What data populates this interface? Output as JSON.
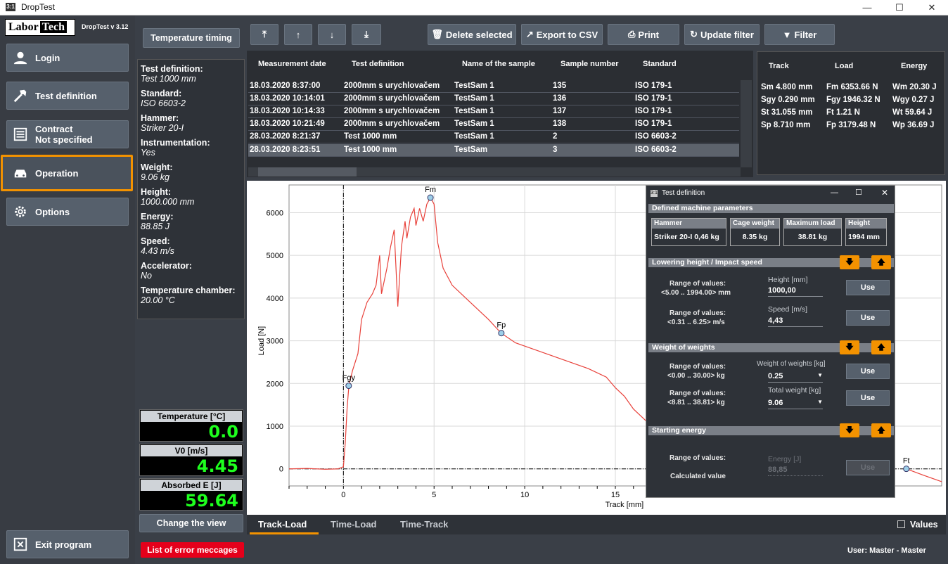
{
  "window": {
    "title": "DropTest",
    "app_icon": "3:1"
  },
  "sidebar": {
    "logo_left": "Labor",
    "logo_right": "Tech",
    "version": "DropTest v 3.12",
    "items": [
      {
        "label": "Login",
        "icon": "user-icon"
      },
      {
        "label": "Test definition",
        "icon": "hammer-icon"
      },
      {
        "label": "Contract",
        "label2": "Not specified",
        "icon": "document-icon"
      },
      {
        "label": "Operation",
        "icon": "car-icon",
        "active": true
      },
      {
        "label": "Options",
        "icon": "gear-icon"
      }
    ],
    "exit": "Exit program"
  },
  "temperature_timing": "Temperature timing",
  "info": {
    "test_definition_label": "Test definition:",
    "test_definition": "Test 1000 mm",
    "standard_label": "Standard:",
    "standard": "ISO 6603-2",
    "hammer_label": "Hammer:",
    "hammer": "Striker 20-I",
    "instrumentation_label": "Instrumentation:",
    "instrumentation": "Yes",
    "weight_label": "Weight:",
    "weight": "9.06   kg",
    "height_label": "Height:",
    "height": "1000.000   mm",
    "energy_label": "Energy:",
    "energy": "88.85   J",
    "speed_label": "Speed:",
    "speed": "4.43   m/s",
    "accelerator_label": "Accelerator:",
    "accelerator": "No",
    "chamber_label": "Temperature chamber:",
    "chamber": "20.00 °C"
  },
  "gauges": [
    {
      "label": "Temperature [°C]",
      "value": "0.0"
    },
    {
      "label": "V0 [m/s]",
      "value": "4.45"
    },
    {
      "label": "Absorbed E [J]",
      "value": "59.64"
    }
  ],
  "change_view": "Change the view",
  "toolbar": {
    "delete": "Delete selected",
    "export": "Export to CSV",
    "print": "Print",
    "update": "Update filter",
    "filter": "Filter"
  },
  "table": {
    "headers": [
      "Measurement date",
      "Test definition",
      "Name of the sample",
      "Sample number",
      "Standard"
    ],
    "rows": [
      [
        "18.03.2020 8:37:00",
        "2000mm s urychlovačem",
        "TestSam 1",
        "135",
        "ISO 179-1"
      ],
      [
        "18.03.2020 10:14:01",
        "2000mm s urychlovačem",
        "TestSam 1",
        "136",
        "ISO 179-1"
      ],
      [
        "18.03.2020 10:14:33",
        "2000mm s urychlovačem",
        "TestSam 1",
        "137",
        "ISO 179-1"
      ],
      [
        "18.03.2020 10:21:49",
        "2000mm s urychlovačem",
        "TestSam 1",
        "138",
        "ISO 179-1"
      ],
      [
        "28.03.2020 8:21:37",
        "Test 1000 mm",
        "TestSam 1",
        "2",
        "ISO 6603-2"
      ],
      [
        "28.03.2020 8:23:51",
        "Test 1000 mm",
        "TestSam",
        "3",
        "ISO 6603-2"
      ]
    ]
  },
  "results": {
    "headers": [
      "Track",
      "Load",
      "Energy"
    ],
    "rows": [
      [
        "Sm 4.800 mm",
        "Fm 6353.66 N",
        "Wm 20.30 J"
      ],
      [
        "Sgy 0.290 mm",
        "Fgy 1946.32 N",
        "Wgy 0.27 J"
      ],
      [
        "St 31.055 mm",
        "Ft 1.21 N",
        "Wt 59.64 J"
      ],
      [
        "Sp 8.710 mm",
        "Fp 3179.48 N",
        "Wp 36.69 J"
      ]
    ]
  },
  "chart_data": {
    "type": "line",
    "xlabel": "Track [mm]",
    "ylabel": "Load [N]",
    "xlim": [
      -3,
      33
    ],
    "ylim": [
      -400,
      6650
    ],
    "xticks": [
      0,
      5,
      10,
      15
    ],
    "yticks": [
      0,
      1000,
      2000,
      3000,
      4000,
      5000,
      6000
    ],
    "series": [
      {
        "color": "#e8413a",
        "x": [
          -3,
          -2,
          -1,
          -0.3,
          0,
          0.1,
          0.2,
          0.3,
          0.5,
          0.8,
          1.0,
          1.3,
          1.6,
          1.8,
          2.0,
          2.1,
          2.2,
          2.4,
          2.6,
          2.8,
          3.0,
          3.2,
          3.4,
          3.5,
          3.7,
          3.9,
          4.0,
          4.2,
          4.4,
          4.6,
          4.8,
          5.0,
          5.2,
          5.5,
          6.0,
          6.5,
          7.0,
          7.5,
          8.0,
          8.7,
          9.5,
          10.5,
          11.5,
          12.5,
          13.5,
          14.5,
          15.0,
          15.5,
          16.0,
          16.5,
          17.0
        ],
        "y": [
          0,
          10,
          -10,
          0,
          50,
          600,
          1400,
          1946,
          2300,
          2700,
          3500,
          3900,
          4100,
          4300,
          5000,
          4100,
          4300,
          4700,
          5200,
          5600,
          3800,
          5200,
          5800,
          5400,
          5900,
          6100,
          5700,
          6100,
          5800,
          6200,
          6353,
          6200,
          5300,
          4700,
          4300,
          4100,
          3900,
          3700,
          3500,
          3179,
          2950,
          2800,
          2650,
          2500,
          2350,
          2150,
          1900,
          1700,
          1400,
          1200,
          1000
        ]
      }
    ],
    "markers": [
      {
        "label": "Fgy",
        "x": 0.29,
        "y": 1946
      },
      {
        "label": "Fm",
        "x": 4.8,
        "y": 6353
      },
      {
        "label": "Fp",
        "x": 8.71,
        "y": 3179
      }
    ]
  },
  "chart_tail": {
    "label": "Ft",
    "x": 31.05,
    "y": 1.21,
    "tail_x": [
      31.05,
      32.0,
      33.0
    ],
    "tail_y": [
      1.21,
      -150,
      -300
    ]
  },
  "tabs": [
    "Track-Load",
    "Time-Load",
    "Time-Track"
  ],
  "values_checkbox": "Values",
  "status": {
    "errors": "List of error meccages",
    "user": "User:  Master  -  Master"
  },
  "dialog": {
    "title": "Test definition",
    "machine_section": "Defined machine parameters",
    "hammer_h": "Hammer",
    "hammer_v": "Striker 20-I   0,46 kg",
    "cage_h": "Cage weight",
    "cage_v": "8.35   kg",
    "maxload_h": "Maximum load",
    "maxload_v": "38.81   kg",
    "height_h": "Height",
    "height_v": "1994   mm",
    "lowering_section": "Lowering height / Impact speed",
    "range1": "Range of values:",
    "range1v": "<5.00 .. 1994.00> mm",
    "height_field_label": "Height [mm]",
    "height_field": "1000,00",
    "range2": "Range of values:",
    "range2v": "<0.31 .. 6.25> m/s",
    "speed_field_label": "Speed [m/s]",
    "speed_field": "4,43",
    "weights_section": "Weight of weights",
    "range3": "Range of values:",
    "range3v": "<0.00 .. 30.00> kg",
    "wow_label": "Weight of weights [kg]",
    "wow": "0.25",
    "range4": "Range of values:",
    "range4v": "<8.81 .. 38.81> kg",
    "total_label": "Total weight [kg]",
    "total": "9.06",
    "energy_section": "Starting energy",
    "range5": "Range of values:",
    "calc": "Calculated value",
    "energy_label": "Energy [J]",
    "energy": "88,85",
    "use": "Use"
  }
}
